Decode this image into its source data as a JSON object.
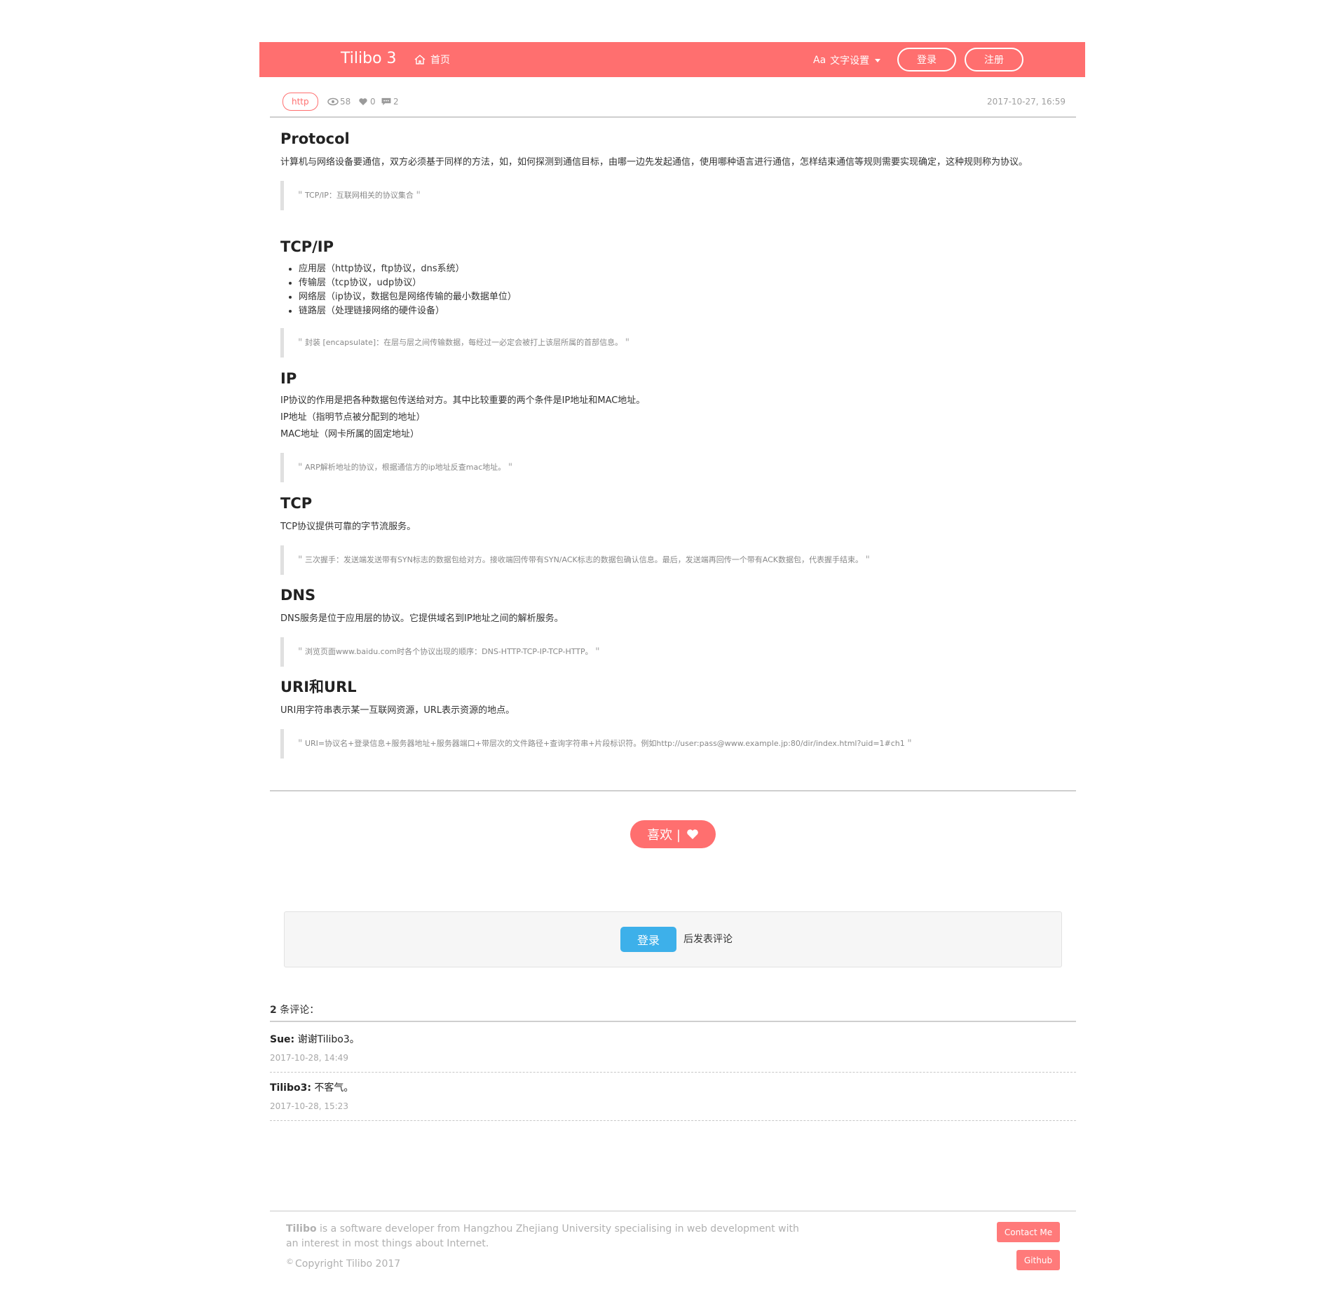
{
  "navbar": {
    "brand": "Tilibo 3",
    "home_label": "首页",
    "text_settings_icon": "Aa",
    "text_settings_label": "文字设置",
    "login_label": "登录",
    "register_label": "注册"
  },
  "post_meta": {
    "tag": "http",
    "views": "58",
    "likes": "0",
    "comments": "2",
    "date": "2017-10-27, 16:59"
  },
  "sections": {
    "protocol": {
      "title": "Protocol",
      "body": "计算机与网络设备要通信，双方必须基于同样的方法，如，如何探测到通信目标，由哪一边先发起通信，使用哪种语言进行通信，怎样结束通信等规则需要实现确定，这种规则称为协议。",
      "quote": "TCP/IP：互联网相关的协议集合"
    },
    "tcpip": {
      "title": "TCP/IP",
      "items": [
        "应用层（http协议，ftp协议，dns系统）",
        "传输层（tcp协议，udp协议）",
        "网络层（ip协议，数据包是网络传输的最小数据单位）",
        "链路层（处理链接网络的硬件设备）"
      ],
      "quote": "封装 [encapsulate]：在层与层之间传输数据，每经过一必定会被打上该层所属的首部信息。"
    },
    "ip": {
      "title": "IP",
      "lines": [
        "IP协议的作用是把各种数据包传送给对方。其中比较重要的两个条件是IP地址和MAC地址。",
        "IP地址（指明节点被分配到的地址）",
        "MAC地址（网卡所属的固定地址）"
      ],
      "quote": "ARP解析地址的协议，根据通信方的ip地址反查mac地址。"
    },
    "tcp": {
      "title": "TCP",
      "body": "TCP协议提供可靠的字节流服务。",
      "quote": "三次握手：发送端发送带有SYN标志的数据包给对方。接收端回传带有SYN/ACK标志的数据包确认信息。最后，发送端再回传一个带有ACK数据包，代表握手结束。"
    },
    "dns": {
      "title": "DNS",
      "body": "DNS服务是位于应用层的协议。它提供域名到IP地址之间的解析服务。",
      "quote": "浏览页面www.baidu.com时各个协议出现的顺序：DNS-HTTP-TCP-IP-TCP-HTTP。"
    },
    "uri": {
      "title": "URI和URL",
      "body": "URI用字符串表示某一互联网资源，URL表示资源的地点。",
      "quote": "URI=协议名+登录信息+服务器地址+服务器端口+带层次的文件路径+查询字符串+片段标识符。例如http://user:pass@www.example.jp:80/dir/index.html?uid=1#ch1"
    },
    "quote_open": "\"",
    "quote_close": "\""
  },
  "like_button": {
    "label": "喜欢 |"
  },
  "comment_box": {
    "login_label": "登录",
    "text": "后发表评论"
  },
  "comments": {
    "count": "2",
    "count_suffix": " 条评论：",
    "items": [
      {
        "author": "Sue:",
        "text": " 谢谢Tilibo3。",
        "time": "2017-10-28, 14:49"
      },
      {
        "author": "Tilibo3:",
        "text": " 不客气。",
        "time": "2017-10-28, 15:23"
      }
    ]
  },
  "footer": {
    "brand": "Tilibo",
    "description": " is a software developer from Hangzhou Zhejiang University specialising in web development with an interest in most things about Internet.",
    "copyright": "Copyright Tilibo 2017",
    "copyright_symbol": "©",
    "contact_label": "Contact Me",
    "github_label": "Github"
  },
  "colors": {
    "accent": "#ff6f6f",
    "login_blue": "#3db0ea",
    "muted_text": "#a0a0a0"
  },
  "icons": [
    "home-icon",
    "eye-icon",
    "heart-icon",
    "comment-icon",
    "caret-down-icon",
    "heart-icon",
    "copyright-icon"
  ]
}
